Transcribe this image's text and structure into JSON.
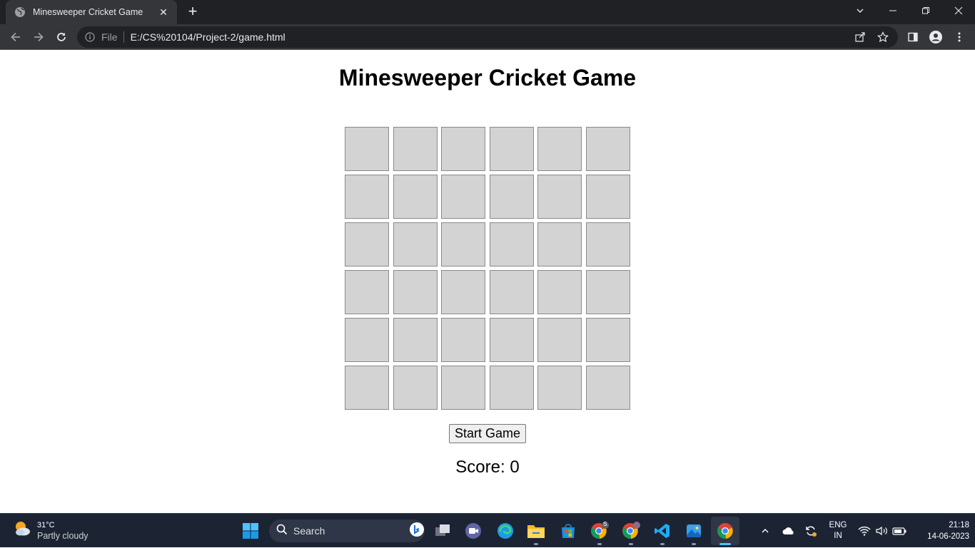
{
  "browser": {
    "tab_title": "Minesweeper Cricket Game",
    "url_scheme": "File",
    "url": "E:/CS%20104/Project-2/game.html"
  },
  "page": {
    "heading": "Minesweeper Cricket Game",
    "grid": {
      "rows": 6,
      "cols": 6
    },
    "start_button": "Start Game",
    "score_text": "Score: 0"
  },
  "taskbar": {
    "weather_temp": "31°C",
    "weather_condition": "Partly cloudy",
    "search_label": "Search",
    "language_top": "ENG",
    "language_bottom": "IN",
    "time": "21:18",
    "date": "14-06-2023",
    "badge_s": "S"
  },
  "colors": {
    "cell_fill": "#d3d3d3",
    "chrome_dark": "#202124",
    "chrome_toolbar": "#35363a",
    "taskbar_bg": "#1c2434"
  }
}
